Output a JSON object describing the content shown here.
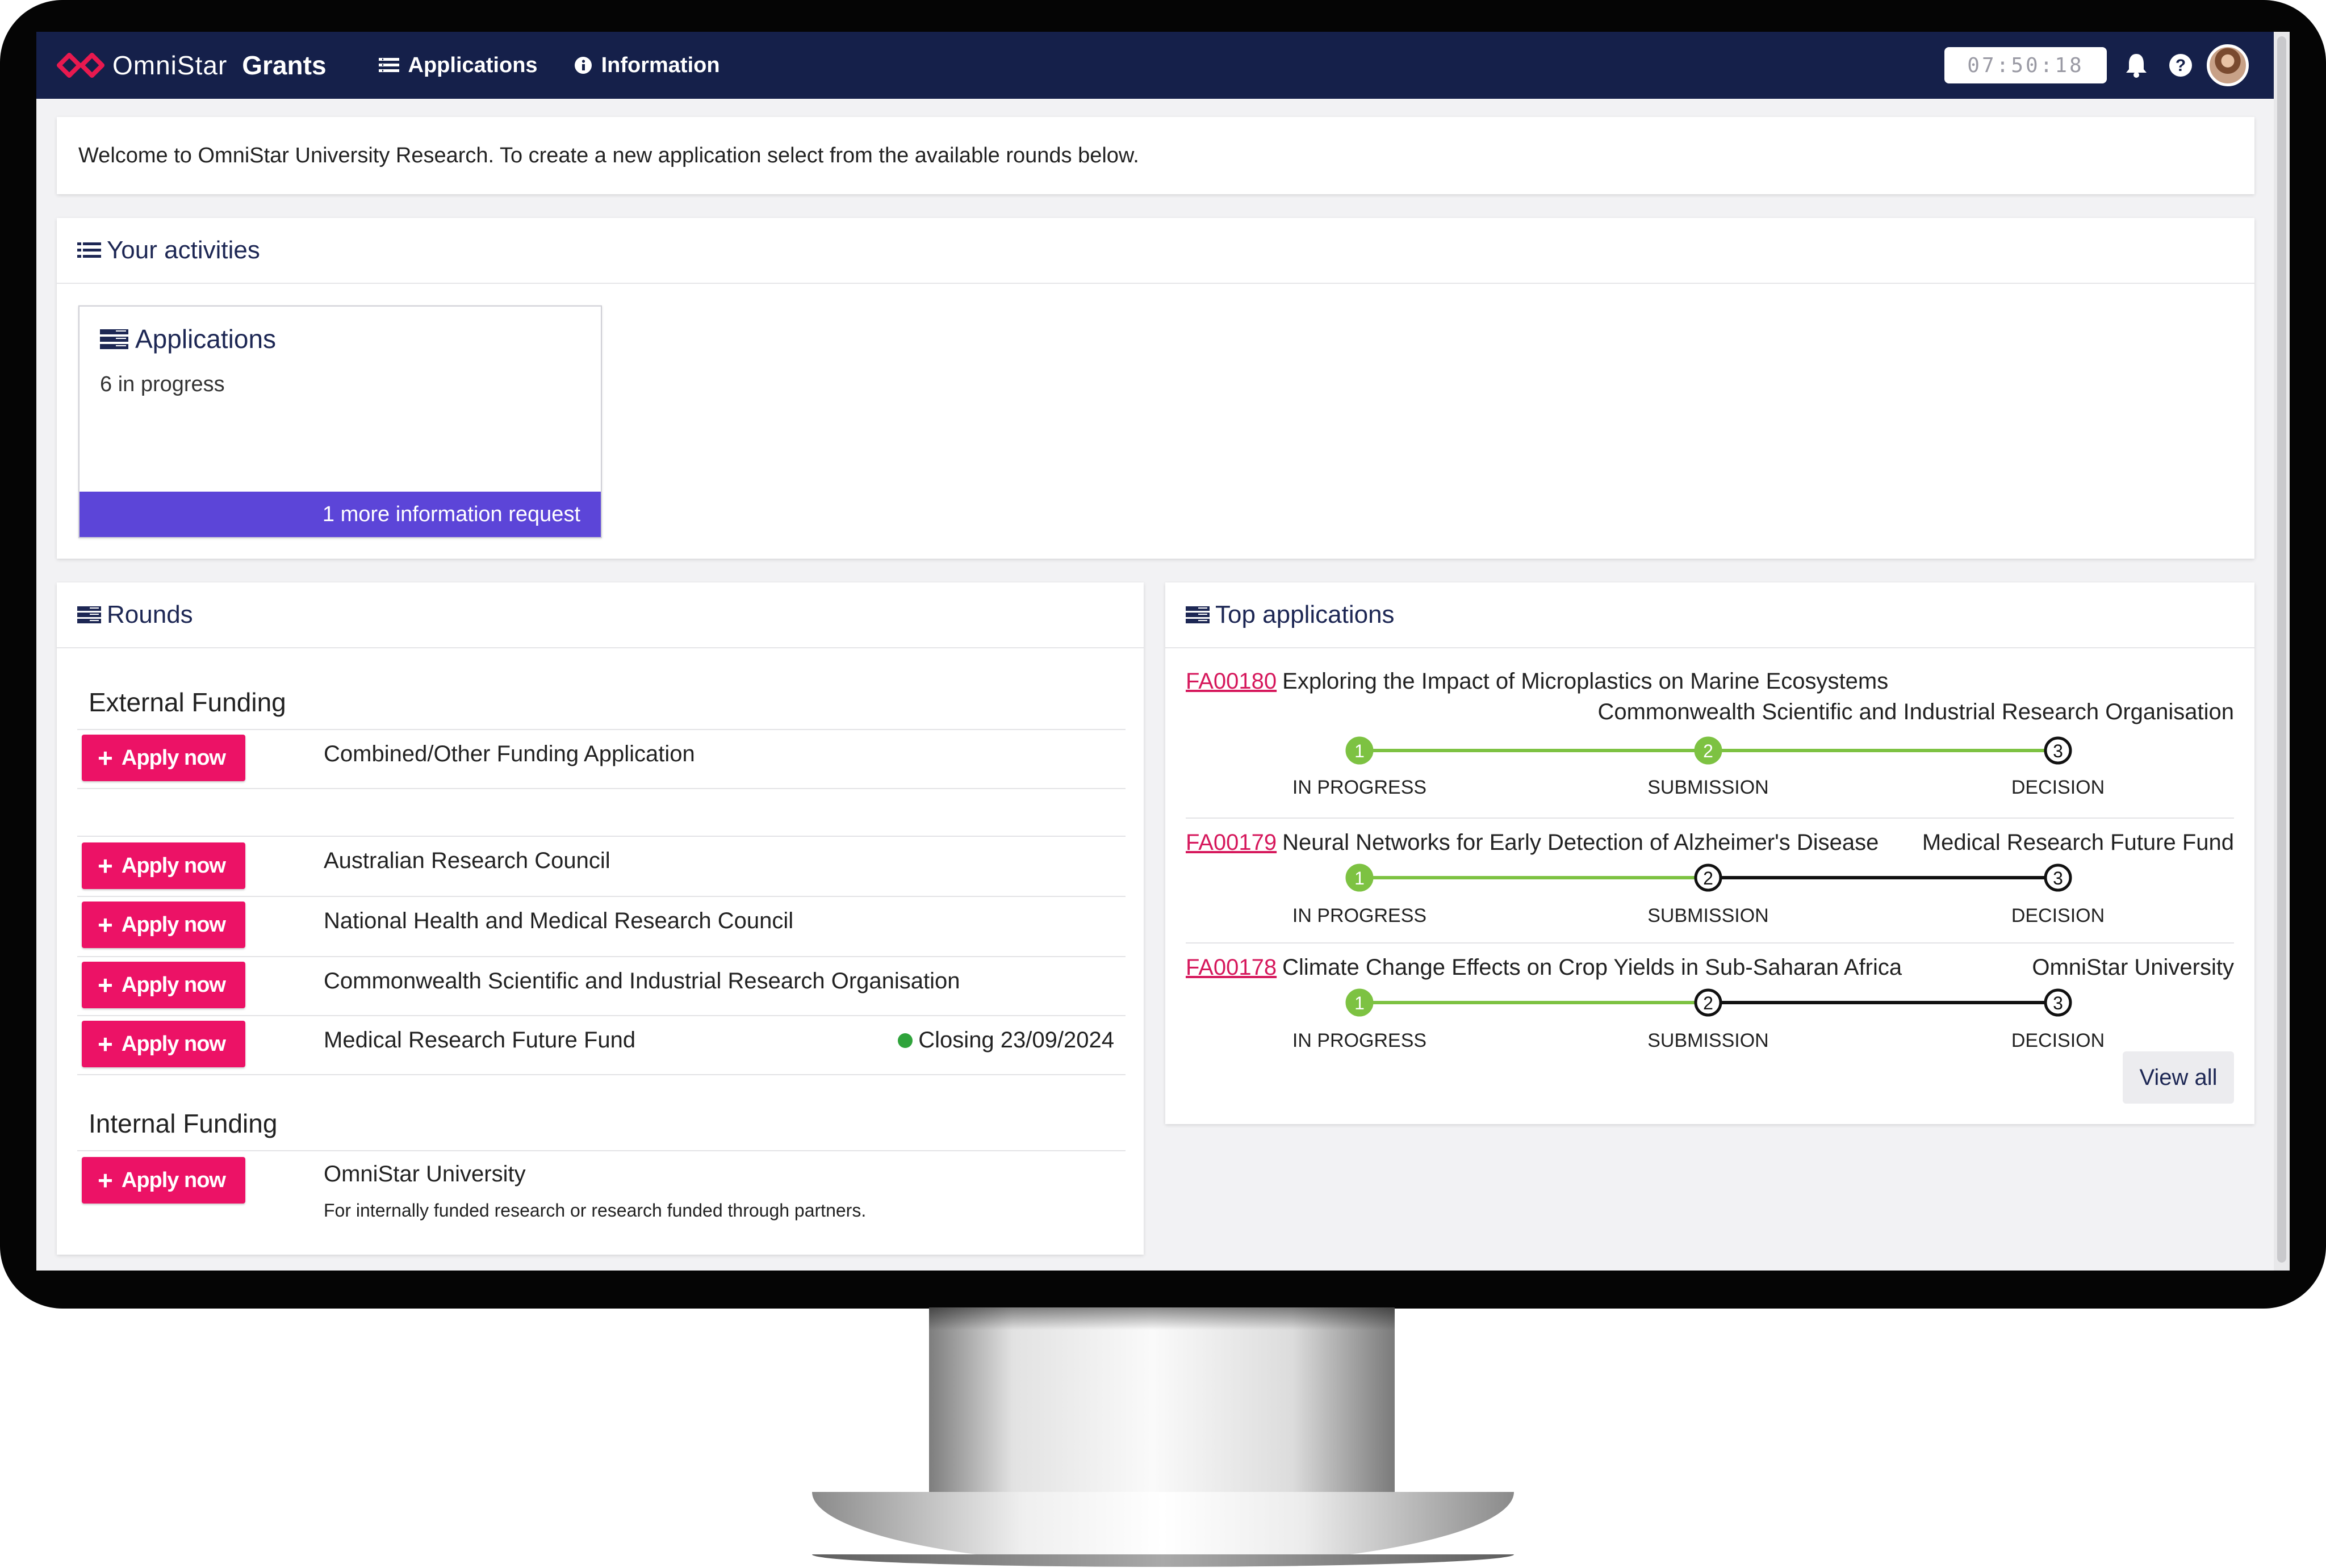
{
  "navbar": {
    "brand_name": "OmniStar",
    "brand_product": "Grants",
    "nav_items": [
      {
        "label": "Applications",
        "icon": "list-icon"
      },
      {
        "label": "Information",
        "icon": "info-icon"
      }
    ],
    "clock": "07:50:18",
    "colors": {
      "bar": "#15204a",
      "logo": "#e8194f"
    }
  },
  "welcome": {
    "text": "Welcome to OmniStar University Research.  To create a new application select from the available rounds below."
  },
  "activities": {
    "title": "Your activities",
    "card": {
      "title": "Applications",
      "subtitle": "6 in progress",
      "footer": "1 more information request",
      "footer_color": "#5c45d8"
    }
  },
  "rounds": {
    "title": "Rounds",
    "apply_label": "Apply now",
    "apply_color": "#ec1266",
    "groups": [
      {
        "title": "External Funding",
        "items": [
          {
            "label": "Combined/Other Funding Application"
          },
          {
            "label": "Australian Research Council"
          },
          {
            "label": "National Health and Medical Research Council"
          },
          {
            "label": "Commonwealth Scientific and Industrial Research Organisation"
          },
          {
            "label": "Medical Research Future Fund",
            "closing": "Closing 23/09/2024"
          }
        ]
      },
      {
        "title": "Internal Funding",
        "items": [
          {
            "label": "OmniStar University",
            "description": "For internally funded research or research funded through partners."
          }
        ]
      }
    ]
  },
  "top_applications": {
    "title": "Top applications",
    "step_labels": [
      "IN PROGRESS",
      "SUBMISSION",
      "DECISION"
    ],
    "step_numbers": [
      "1",
      "2",
      "3"
    ],
    "completed_color": "#7dc242",
    "items": [
      {
        "code": "FA00180",
        "title": "Exploring the Impact of Microplastics on Marine Ecosystems",
        "org": "Commonwealth Scientific and Industrial Research Organisation",
        "completed_steps": 2
      },
      {
        "code": "FA00179",
        "title": "Neural Networks for Early Detection of Alzheimer's Disease",
        "org": "Medical Research Future Fund",
        "completed_steps": 1
      },
      {
        "code": "FA00178",
        "title": "Climate Change Effects on Crop Yields in Sub-Saharan Africa",
        "org": "OmniStar University",
        "completed_steps": 1
      }
    ],
    "view_all": "View all"
  }
}
